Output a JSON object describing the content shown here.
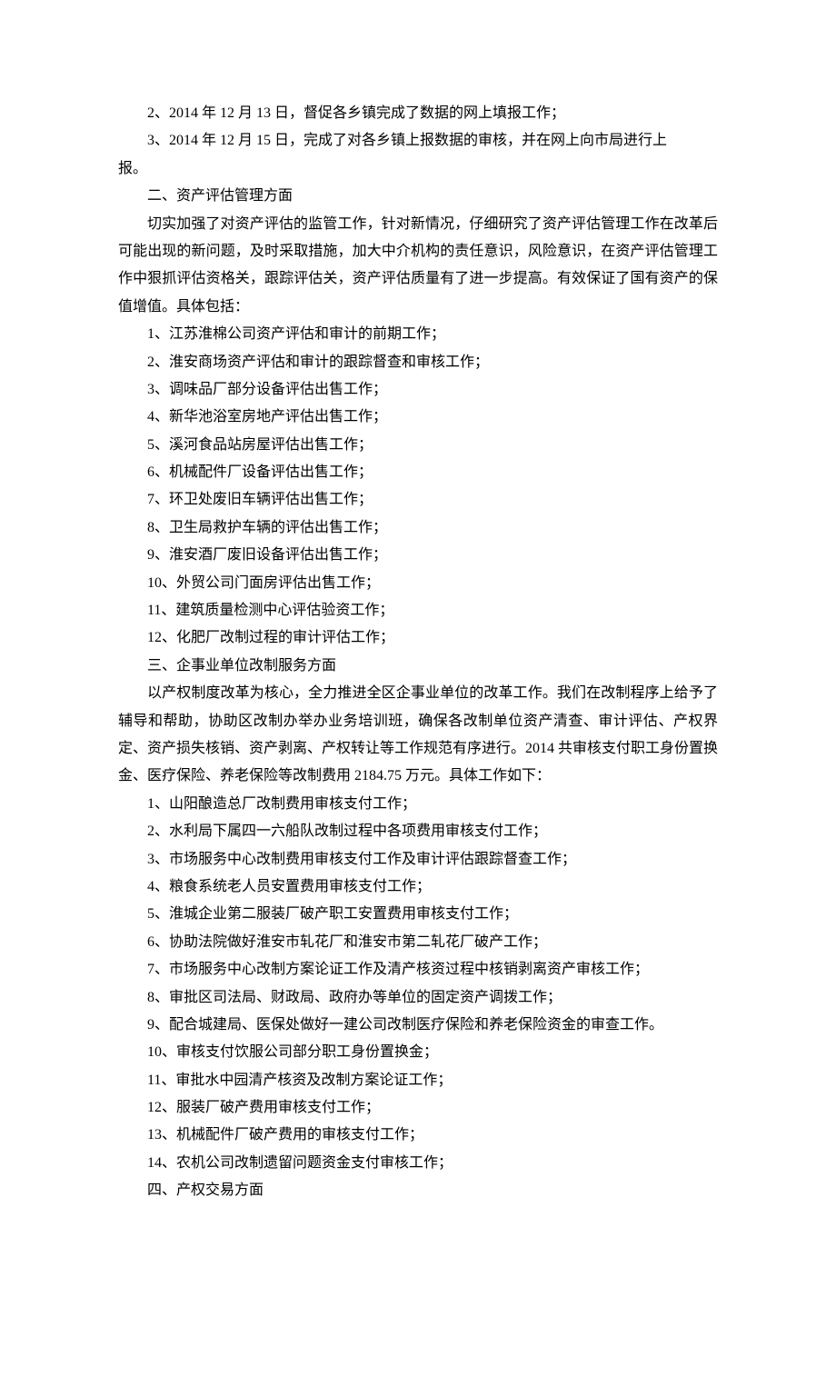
{
  "lines": {
    "l1": "2、2014 年 12 月 13 日，督促各乡镇完成了数据的网上填报工作；",
    "l2": "3、2014 年 12 月 15 日，完成了对各乡镇上报数据的审核，并在网上向市局进行上",
    "l2b": "报。",
    "l3": "二、资产评估管理方面",
    "l4": "切实加强了对资产评估的监管工作，针对新情况，仔细研究了资产评估管理工作在改革后可能出现的新问题，及时采取措施，加大中介机构的责任意识，风险意识，在资产评估管理工作中狠抓评估资格关，跟踪评估关，资产评估质量有了进一步提高。有效保证了国有资产的保值增值。具体包括：",
    "l5": "1、江苏淮棉公司资产评估和审计的前期工作；",
    "l6": "2、淮安商场资产评估和审计的跟踪督查和审核工作；",
    "l7": "3、调味品厂部分设备评估出售工作；",
    "l8": "4、新华池浴室房地产评估出售工作；",
    "l9": "5、溪河食品站房屋评估出售工作；",
    "l10": "6、机械配件厂设备评估出售工作；",
    "l11": "7、环卫处废旧车辆评估出售工作；",
    "l12": "8、卫生局救护车辆的评估出售工作；",
    "l13": "9、淮安酒厂废旧设备评估出售工作；",
    "l14": "10、外贸公司门面房评估出售工作；",
    "l15": "11、建筑质量检测中心评估验资工作；",
    "l16": "12、化肥厂改制过程的审计评估工作；",
    "l17": "三、企事业单位改制服务方面",
    "l18": "以产权制度改革为核心，全力推进全区企事业单位的改革工作。我们在改制程序上给予了辅导和帮助，协助区改制办举办业务培训班，确保各改制单位资产清查、审计评估、产权界定、资产损失核销、资产剥离、产权转让等工作规范有序进行。2014 共审核支付职工身份置换金、医疗保险、养老保险等改制费用 2184.75 万元。具体工作如下：",
    "l19": "1、山阳酿造总厂改制费用审核支付工作；",
    "l20": "2、水利局下属四一六船队改制过程中各项费用审核支付工作；",
    "l21": "3、市场服务中心改制费用审核支付工作及审计评估跟踪督查工作；",
    "l22": "4、粮食系统老人员安置费用审核支付工作；",
    "l23": "5、淮城企业第二服装厂破产职工安置费用审核支付工作；",
    "l24": "6、协助法院做好淮安市轧花厂和淮安市第二轧花厂破产工作；",
    "l25": "7、市场服务中心改制方案论证工作及清产核资过程中核销剥离资产审核工作；",
    "l26": "8、审批区司法局、财政局、政府办等单位的固定资产调拨工作；",
    "l27": "9、配合城建局、医保处做好一建公司改制医疗保险和养老保险资金的审查工作。",
    "l28": "10、审核支付饮服公司部分职工身份置换金；",
    "l29": "11、审批水中园清产核资及改制方案论证工作；",
    "l30": "12、服装厂破产费用审核支付工作；",
    "l31": "13、机械配件厂破产费用的审核支付工作；",
    "l32": "14、农机公司改制遗留问题资金支付审核工作；",
    "l33": "四、产权交易方面"
  }
}
